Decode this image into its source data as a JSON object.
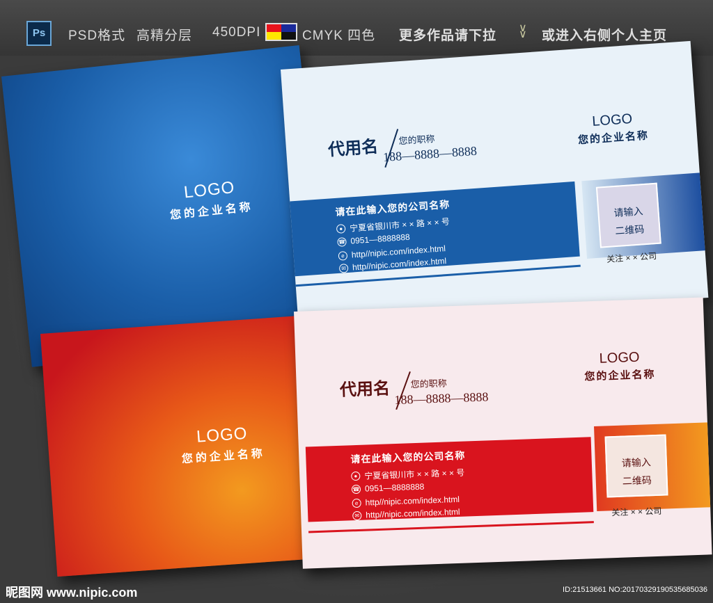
{
  "header": {
    "ps_icon_label": "Ps",
    "format_label": "PSD格式",
    "layers_label": "高精分层",
    "dpi_label": "450DPI",
    "color_mode_label": "CMYK 四色",
    "more_label": "更多作品请下拉",
    "enter_label": "或进入右侧个人主页",
    "swatch_colors": [
      "#e8131b",
      "#1a2a9a",
      "#ffe600",
      "#111111"
    ]
  },
  "blue_card": {
    "back_logo": "LOGO",
    "back_company": "您的企业名称",
    "name": "代用名",
    "job_title": "您的职称",
    "phone": "188—8888—8888",
    "logo": "LOGO",
    "company_name": "您的企业名称",
    "band_company": "请在此输入您的公司名称",
    "address": "宁夏省银川市 × × 路 × × 号",
    "tel": "0951—8888888",
    "url1": "http//nipic.com/index.html",
    "url2": "http//nipic.com/index.html",
    "qr_line1": "请输入",
    "qr_line2": "二维码",
    "follow": "关注 × × 公司",
    "accent": "#1a5ea8"
  },
  "red_card": {
    "back_logo": "LOGO",
    "back_company": "您的企业名称",
    "name": "代用名",
    "job_title": "您的职称",
    "phone": "188—8888—8888",
    "logo": "LOGO",
    "company_name": "您的企业名称",
    "band_company": "请在此输入您的公司名称",
    "address": "宁夏省银川市 × × 路 × × 号",
    "tel": "0951—8888888",
    "url1": "http//nipic.com/index.html",
    "url2": "http//nipic.com/index.html",
    "qr_line1": "请输入",
    "qr_line2": "二维码",
    "follow": "关注 × × 公司",
    "accent": "#d9141e"
  },
  "footer": {
    "watermark": "昵图网 www.nipic.com",
    "id_text": "ID:21513661 NO:20170329190535685036"
  }
}
